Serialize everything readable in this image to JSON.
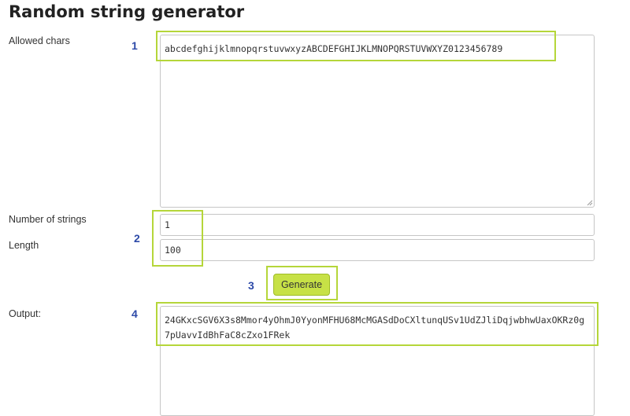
{
  "page": {
    "title": "Random string generator"
  },
  "allowed": {
    "label": "Allowed chars",
    "value": "abcdefghijklmnopqrstuvwxyzABCDEFGHIJKLMNOPQRSTUVWXYZ0123456789",
    "marker": "1"
  },
  "count": {
    "label": "Number of strings",
    "value": "1"
  },
  "length": {
    "label": "Length",
    "value": "100"
  },
  "fields_marker": "2",
  "generate": {
    "label": "Generate",
    "marker": "3"
  },
  "output": {
    "label": "Output:",
    "value": "24GKxcSGV6X3s8Mmor4yOhmJ0YyonMFHU68McMGASdDoCXltunqUSv1UdZJliDqjwbhwUaxOKRz0g7pUavvIdBhFaC8cZxo1FRek",
    "marker": "4"
  },
  "highlight_color": "#b5d63a",
  "button_color": "#c7e146",
  "marker_color": "#2d4aa8",
  "icons": {
    "resize": "resize-grip-icon"
  }
}
